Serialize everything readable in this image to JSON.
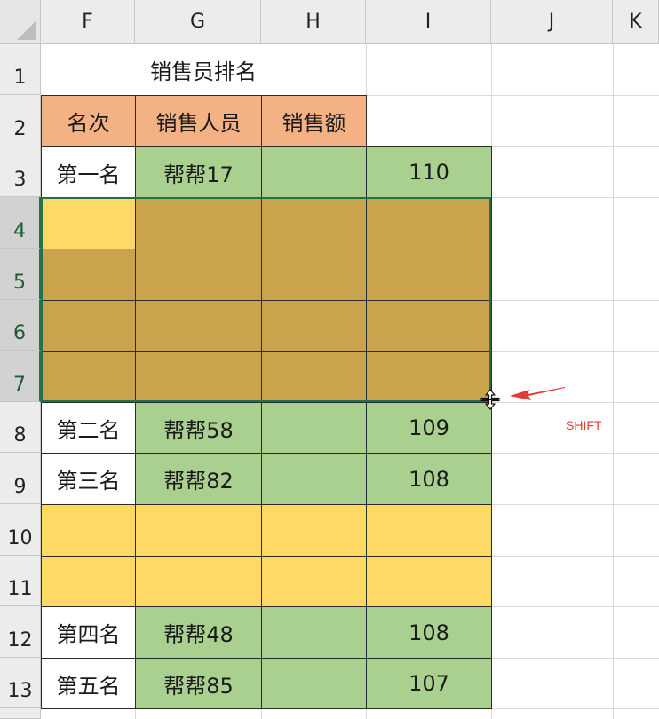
{
  "columns": [
    "F",
    "G",
    "H",
    "I",
    "J",
    "K"
  ],
  "rows": [
    "1",
    "2",
    "3",
    "4",
    "5",
    "6",
    "7",
    "8",
    "9",
    "10",
    "11",
    "12",
    "13"
  ],
  "title": "销售员排名",
  "headers": {
    "rank": "名次",
    "salesperson": "销售人员",
    "amount": "销售额"
  },
  "records": [
    {
      "row": "3",
      "rank": "第一名",
      "name": "帮帮17",
      "value": "110"
    },
    {
      "row": "8",
      "rank": "第二名",
      "name": "帮帮58",
      "value": "109"
    },
    {
      "row": "9",
      "rank": "第三名",
      "name": "帮帮82",
      "value": "108"
    },
    {
      "row": "12",
      "rank": "第四名",
      "name": "帮帮48",
      "value": "108"
    },
    {
      "row": "13",
      "rank": "第五名",
      "name": "帮帮85",
      "value": "107"
    }
  ],
  "annotation": "SHIFT",
  "colors": {
    "header_fill": "#f4b183",
    "record_fill": "#a9d08e",
    "empty_fill": "#ffd966",
    "selection_fill": "#c9a44d",
    "selection_border": "#217346",
    "annotation": "#e53935"
  },
  "icons": {
    "cursor": "move-resize-cursor-icon",
    "pointer": "red-arrow-icon"
  }
}
